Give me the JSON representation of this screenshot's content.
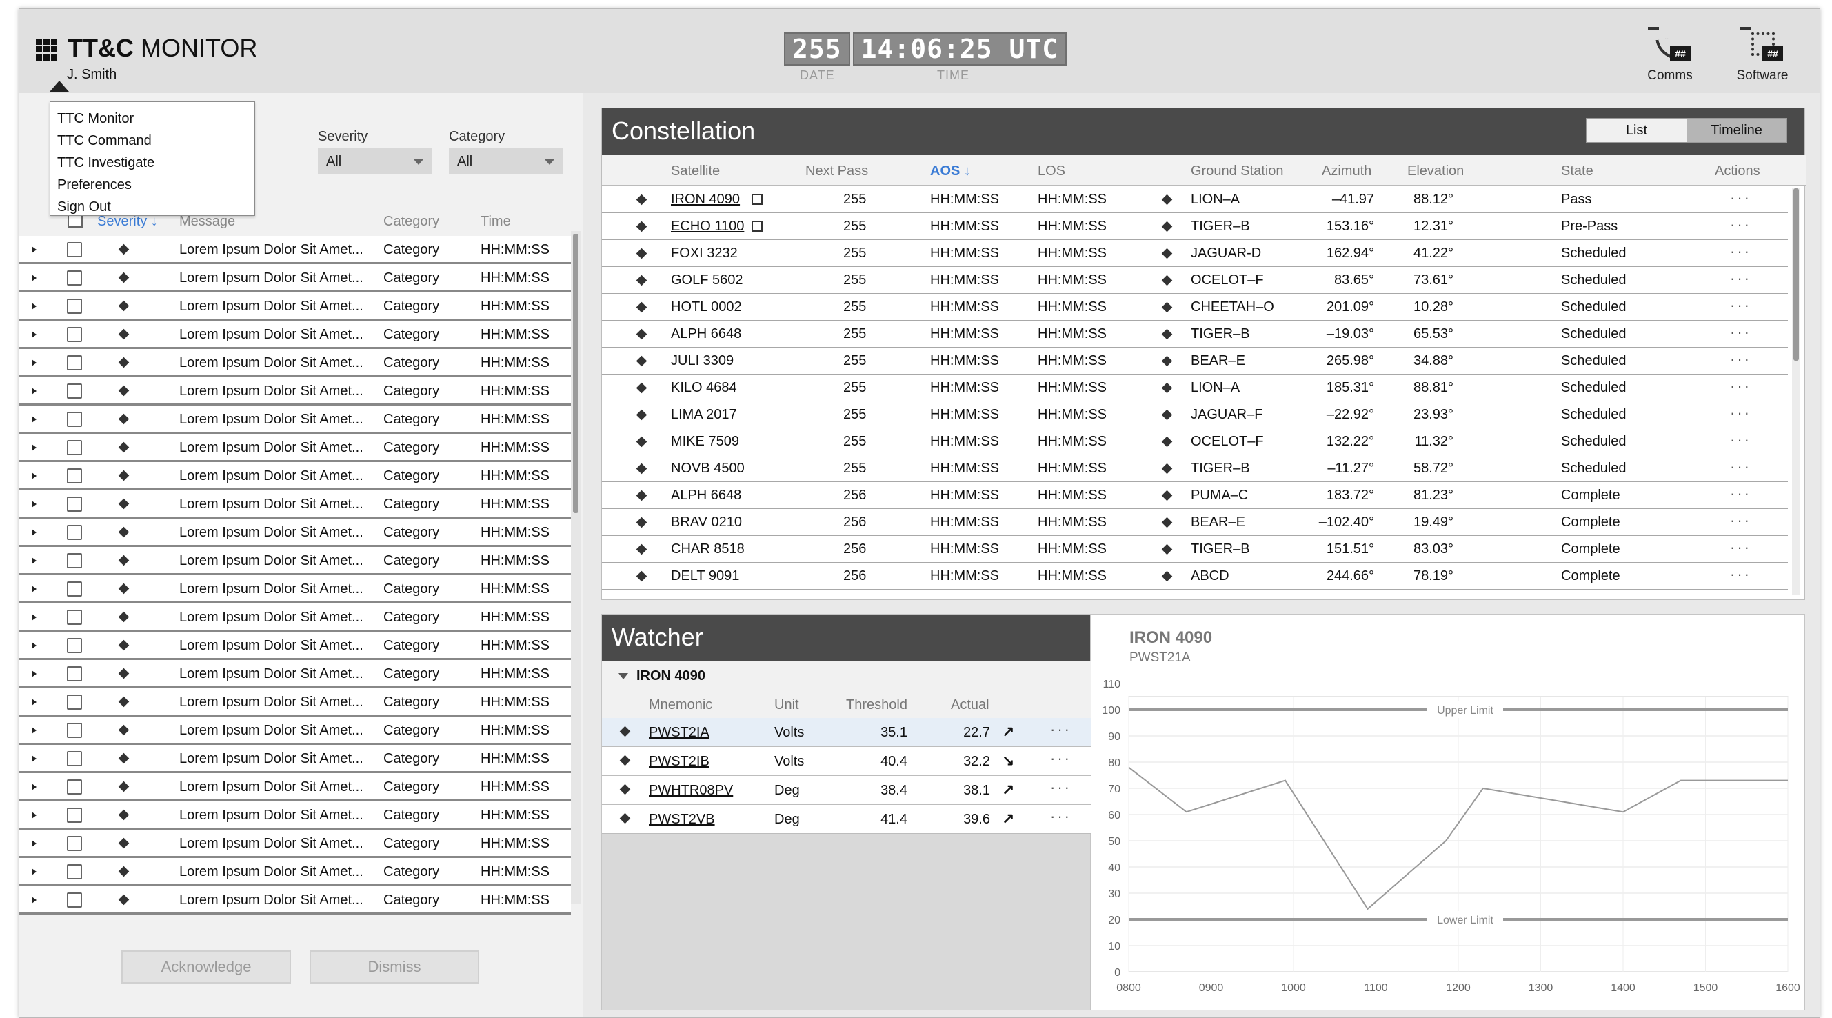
{
  "header": {
    "title_bold": "TT&C",
    "title_rest": " MONITOR",
    "user": "J. Smith",
    "clock": {
      "date": "255",
      "time": "14:06:25 UTC",
      "date_label": "DATE",
      "time_label": "TIME"
    },
    "buttons": [
      {
        "label": "Comms",
        "badge": "##",
        "icon": "satellite-dish-icon"
      },
      {
        "label": "Software",
        "badge": "##",
        "icon": "processor-chip-icon"
      }
    ]
  },
  "user_menu": [
    "TTC Monitor",
    "TTC Command",
    "TTC Investigate",
    "Preferences",
    "Sign Out"
  ],
  "alerts": {
    "filters": {
      "severity_label": "Severity",
      "severity_value": "All",
      "category_label": "Category",
      "category_value": "All"
    },
    "columns": {
      "severity": "Severity ↓",
      "message": "Message",
      "category": "Category",
      "time": "Time"
    },
    "row_template": {
      "message": "Lorem Ipsum Dolor Sit Amet...",
      "category": "Category",
      "time": "HH:MM:SS"
    },
    "row_count": 24,
    "acknowledge_label": "Acknowledge",
    "dismiss_label": "Dismiss"
  },
  "constellation": {
    "title": "Constellation",
    "view_toggle": [
      "List",
      "Timeline"
    ],
    "active_view": "Timeline",
    "columns": [
      "Satellite",
      "Next Pass",
      "AOS ↓",
      "LOS",
      "Ground Station",
      "Azimuth",
      "Elevation",
      "State",
      "Actions"
    ],
    "rows": [
      {
        "sat": "IRON 4090",
        "link": true,
        "pass": "255",
        "aos": "HH:MM:SS",
        "los": "HH:MM:SS",
        "gs": "LION–A",
        "az": "–41.97",
        "el": "88.12°",
        "state": "Pass"
      },
      {
        "sat": "ECHO 1100",
        "link": true,
        "pass": "255",
        "aos": "HH:MM:SS",
        "los": "HH:MM:SS",
        "gs": "TIGER–B",
        "az": "153.16°",
        "el": "12.31°",
        "state": "Pre-Pass"
      },
      {
        "sat": "FOXI 3232",
        "link": false,
        "pass": "255",
        "aos": "HH:MM:SS",
        "los": "HH:MM:SS",
        "gs": "JAGUAR-D",
        "az": "162.94°",
        "el": "41.22°",
        "state": "Scheduled"
      },
      {
        "sat": "GOLF 5602",
        "link": false,
        "pass": "255",
        "aos": "HH:MM:SS",
        "los": "HH:MM:SS",
        "gs": "OCELOT–F",
        "az": "83.65°",
        "el": "73.61°",
        "state": "Scheduled"
      },
      {
        "sat": "HOTL 0002",
        "link": false,
        "pass": "255",
        "aos": "HH:MM:SS",
        "los": "HH:MM:SS",
        "gs": "CHEETAH–O",
        "az": "201.09°",
        "el": "10.28°",
        "state": "Scheduled"
      },
      {
        "sat": "ALPH 6648",
        "link": false,
        "pass": "255",
        "aos": "HH:MM:SS",
        "los": "HH:MM:SS",
        "gs": "TIGER–B",
        "az": "–19.03°",
        "el": "65.53°",
        "state": "Scheduled"
      },
      {
        "sat": "JULI 3309",
        "link": false,
        "pass": "255",
        "aos": "HH:MM:SS",
        "los": "HH:MM:SS",
        "gs": "BEAR–E",
        "az": "265.98°",
        "el": "34.88°",
        "state": "Scheduled"
      },
      {
        "sat": "KILO 4684",
        "link": false,
        "pass": "255",
        "aos": "HH:MM:SS",
        "los": "HH:MM:SS",
        "gs": "LION–A",
        "az": "185.31°",
        "el": "88.81°",
        "state": "Scheduled"
      },
      {
        "sat": "LIMA 2017",
        "link": false,
        "pass": "255",
        "aos": "HH:MM:SS",
        "los": "HH:MM:SS",
        "gs": "JAGUAR–F",
        "az": "–22.92°",
        "el": "23.93°",
        "state": "Scheduled"
      },
      {
        "sat": "MIKE 7509",
        "link": false,
        "pass": "255",
        "aos": "HH:MM:SS",
        "los": "HH:MM:SS",
        "gs": "OCELOT–F",
        "az": "132.22°",
        "el": "11.32°",
        "state": "Scheduled"
      },
      {
        "sat": "NOVB 4500",
        "link": false,
        "pass": "255",
        "aos": "HH:MM:SS",
        "los": "HH:MM:SS",
        "gs": "TIGER–B",
        "az": "–11.27°",
        "el": "58.72°",
        "state": "Scheduled"
      },
      {
        "sat": "ALPH 6648",
        "link": false,
        "pass": "256",
        "aos": "HH:MM:SS",
        "los": "HH:MM:SS",
        "gs": "PUMA–C",
        "az": "183.72°",
        "el": "81.23°",
        "state": "Complete"
      },
      {
        "sat": "BRAV 0210",
        "link": false,
        "pass": "256",
        "aos": "HH:MM:SS",
        "los": "HH:MM:SS",
        "gs": "BEAR–E",
        "az": "–102.40°",
        "el": "19.49°",
        "state": "Complete"
      },
      {
        "sat": "CHAR 8518",
        "link": false,
        "pass": "256",
        "aos": "HH:MM:SS",
        "los": "HH:MM:SS",
        "gs": "TIGER–B",
        "az": "151.51°",
        "el": "83.03°",
        "state": "Complete"
      },
      {
        "sat": "DELT 9091",
        "link": false,
        "pass": "256",
        "aos": "HH:MM:SS",
        "los": "HH:MM:SS",
        "gs": "ABCD",
        "az": "244.66°",
        "el": "78.19°",
        "state": "Complete"
      }
    ],
    "actions_glyph": "···"
  },
  "watcher": {
    "title": "Watcher",
    "group": "IRON 4090",
    "columns": [
      "Mnemonic",
      "Unit",
      "Threshold",
      "Actual"
    ],
    "rows": [
      {
        "mn": "PWST2IA",
        "unit": "Volts",
        "th": "35.1",
        "ac": "22.7",
        "trend": "↗",
        "selected": true
      },
      {
        "mn": "PWST2IB",
        "unit": "Volts",
        "th": "40.4",
        "ac": "32.2",
        "trend": "↘",
        "selected": false
      },
      {
        "mn": "PWHTR08PV",
        "unit": "Deg",
        "th": "38.4",
        "ac": "38.1",
        "trend": "↗",
        "selected": false
      },
      {
        "mn": "PWST2VB",
        "unit": "Deg",
        "th": "41.4",
        "ac": "39.6",
        "trend": "↗",
        "selected": false
      }
    ],
    "actions_glyph": "···"
  },
  "chart_data": {
    "type": "line",
    "title": "IRON 4090",
    "subtitle": "PWST21A",
    "x": [
      "0800",
      "0900",
      "1000",
      "1100",
      "1200",
      "1300",
      "1400",
      "1500",
      "1600"
    ],
    "ylim": [
      0,
      110
    ],
    "yticks": [
      0,
      10,
      20,
      30,
      40,
      50,
      60,
      70,
      80,
      90,
      100,
      110
    ],
    "series": [
      {
        "points": [
          [
            0,
            78
          ],
          [
            0.7,
            61
          ],
          [
            1.9,
            73
          ],
          [
            2.9,
            24
          ],
          [
            3.85,
            50
          ],
          [
            4.3,
            70
          ],
          [
            6.0,
            61
          ],
          [
            6.7,
            73
          ],
          [
            8.0,
            73
          ]
        ]
      }
    ],
    "reference_lines": [
      {
        "label": "Upper Limit",
        "value": 100
      },
      {
        "label": "Lower Limit",
        "value": 20
      }
    ],
    "grid": true,
    "colors": {
      "line": "#999999",
      "limit": "#999999"
    }
  }
}
